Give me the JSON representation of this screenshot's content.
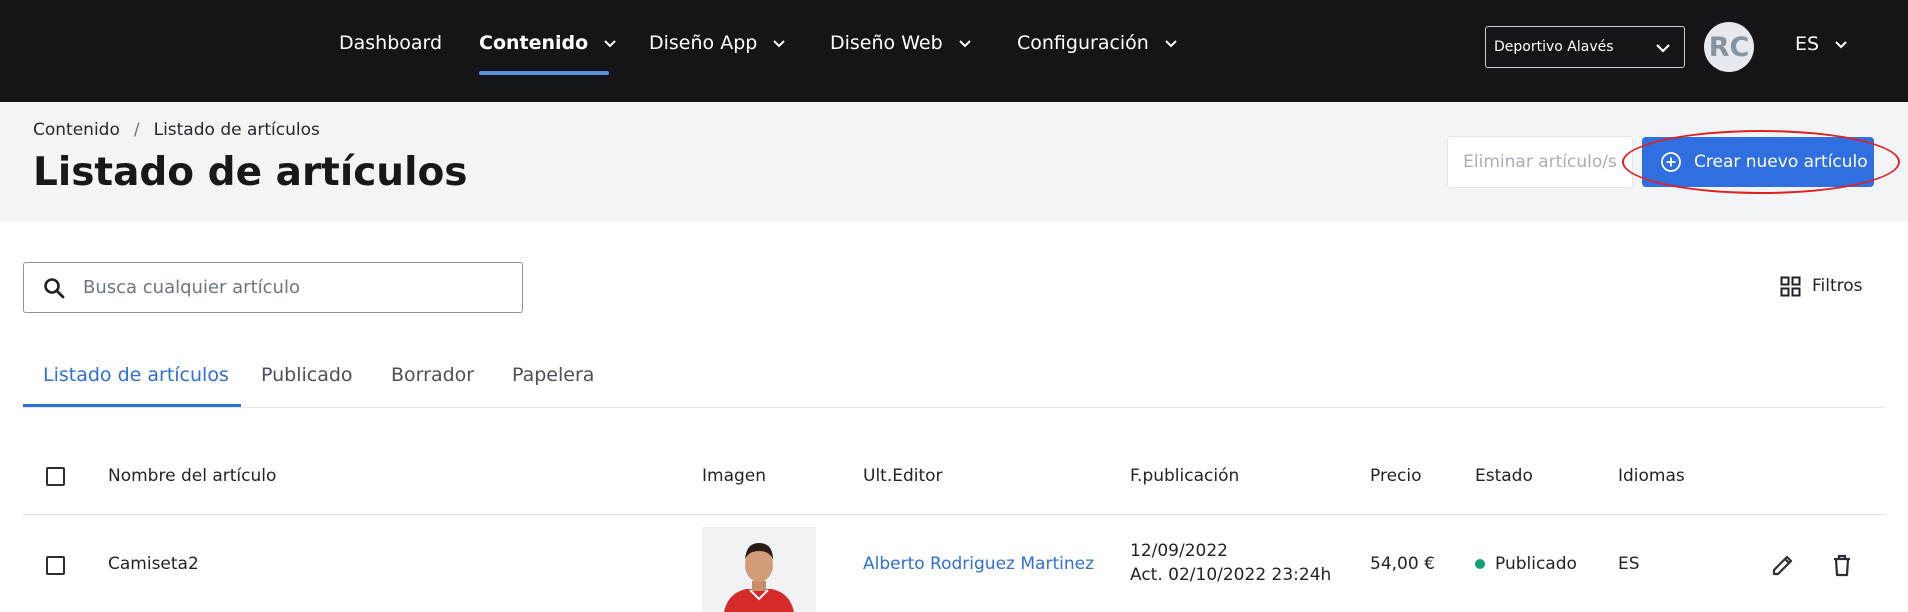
{
  "nav": {
    "items": [
      {
        "label": "Dashboard"
      },
      {
        "label": "Contenido"
      },
      {
        "label": "Diseño App"
      },
      {
        "label": "Diseño Web"
      },
      {
        "label": "Configuración"
      }
    ],
    "active_index": 1,
    "club_select": {
      "value": "Deportivo Alavés"
    },
    "avatar_initials": "RC",
    "language": "ES"
  },
  "header": {
    "breadcrumb": [
      "Contenido",
      "Listado de artículos"
    ],
    "breadcrumb_separator": "/",
    "title": "Listado de artículos",
    "delete_button": "Eliminar artículo/s",
    "create_button": "Crear nuevo artículo"
  },
  "search": {
    "placeholder": "Busca cualquier artículo",
    "value": ""
  },
  "filters_label": "Filtros",
  "tabs": [
    {
      "label": "Listado de artículos"
    },
    {
      "label": "Publicado"
    },
    {
      "label": "Borrador"
    },
    {
      "label": "Papelera"
    }
  ],
  "active_tab": 0,
  "table": {
    "columns": [
      "Nombre del artículo",
      "Imagen",
      "Ult.Editor",
      "F.publicación",
      "Precio",
      "Estado",
      "Idiomas"
    ],
    "rows": [
      {
        "name": "Camiseta2",
        "editor": "Alberto Rodriguez Martinez",
        "date": "12/09/2022",
        "updated": "Act. 02/10/2022 23:24h",
        "price": "54,00 €",
        "status": "Publicado",
        "status_color": "#12a07a",
        "language": "ES",
        "actions": [
          "edit-icon",
          "trash-icon"
        ]
      }
    ]
  },
  "colors": {
    "topbar": "#131518",
    "accent": "#2f6fe0",
    "link": "#2f6fd6",
    "highlight": "#e02020"
  }
}
